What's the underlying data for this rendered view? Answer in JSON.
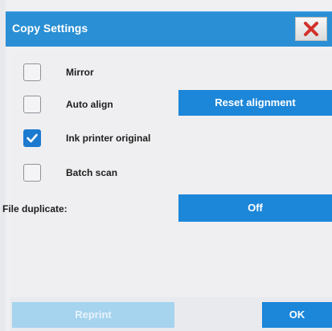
{
  "dialog": {
    "title": "Copy Settings",
    "close_icon": "close-x-icon",
    "accent_color": "#1c86d9",
    "close_color": "#d2302a"
  },
  "options": [
    {
      "label": "Mirror",
      "checked": false
    },
    {
      "label": "Auto align",
      "checked": false
    },
    {
      "label": "Ink printer original",
      "checked": true
    },
    {
      "label": "Batch scan",
      "checked": false
    }
  ],
  "reset_alignment_label": "Reset alignment",
  "file_duplicate": {
    "label": "File duplicate:",
    "value": "Off"
  },
  "footer": {
    "reprint_label": "Reprint",
    "ok_label": "OK"
  }
}
